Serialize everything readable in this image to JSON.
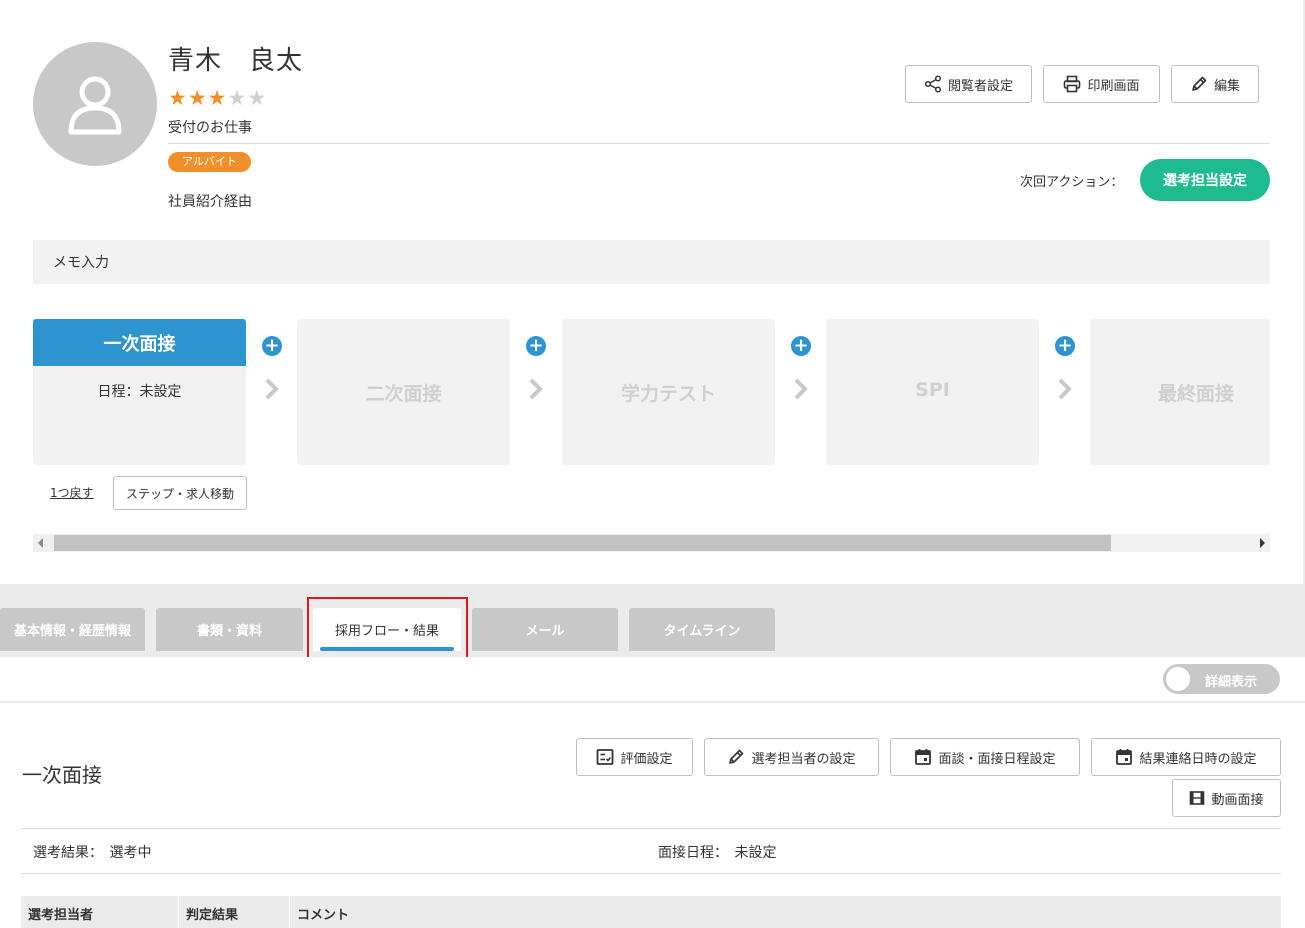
{
  "candidate": {
    "name": "青木　良太",
    "rating": 3,
    "rating_max": 5,
    "job": "受付のお仕事",
    "employment_badge": "アルバイト",
    "source": "社員紹介経由"
  },
  "header_buttons": {
    "viewer_settings": "閲覧者設定",
    "print": "印刷画面",
    "edit": "編集"
  },
  "next_action": {
    "label": "次回アクション：",
    "button": "選考担当設定"
  },
  "memo": {
    "placeholder": "メモ入力"
  },
  "steps": [
    {
      "name": "一次面接",
      "schedule": "日程：未設定",
      "active": true
    },
    {
      "name": "二次面接",
      "active": false
    },
    {
      "name": "学力テスト",
      "active": false
    },
    {
      "name": "SPI",
      "active": false
    },
    {
      "name": "最終面接",
      "active": false
    }
  ],
  "step_actions": {
    "undo": "1つ戻す",
    "move": "ステップ・求人移動"
  },
  "tabs": [
    {
      "label": "基本情報・経歴情報",
      "active": false
    },
    {
      "label": "書類・資料",
      "active": false
    },
    {
      "label": "採用フロー・結果",
      "active": true
    },
    {
      "label": "メール",
      "active": false
    },
    {
      "label": "タイムライン",
      "active": false
    }
  ],
  "detail_toggle": {
    "label": "詳細表示",
    "on": false
  },
  "section": {
    "title": "一次面接",
    "buttons": {
      "evaluation": "評価設定",
      "assignee": "選考担当者の設定",
      "interview_schedule": "面談・面接日程設定",
      "result_notice": "結果連絡日時の設定",
      "video_interview": "動画面接"
    },
    "result_label": "選考結果：",
    "result_value": "選考中",
    "interview_label": "面接日程：",
    "interview_value": "未設定",
    "table_headers": [
      "選考担当者",
      "判定結果",
      "コメント"
    ]
  },
  "colors": {
    "primary_blue": "#2d94d0",
    "accent_green": "#1dbb8e",
    "badge_orange": "#f0902b",
    "highlight_red": "#e0181c"
  }
}
